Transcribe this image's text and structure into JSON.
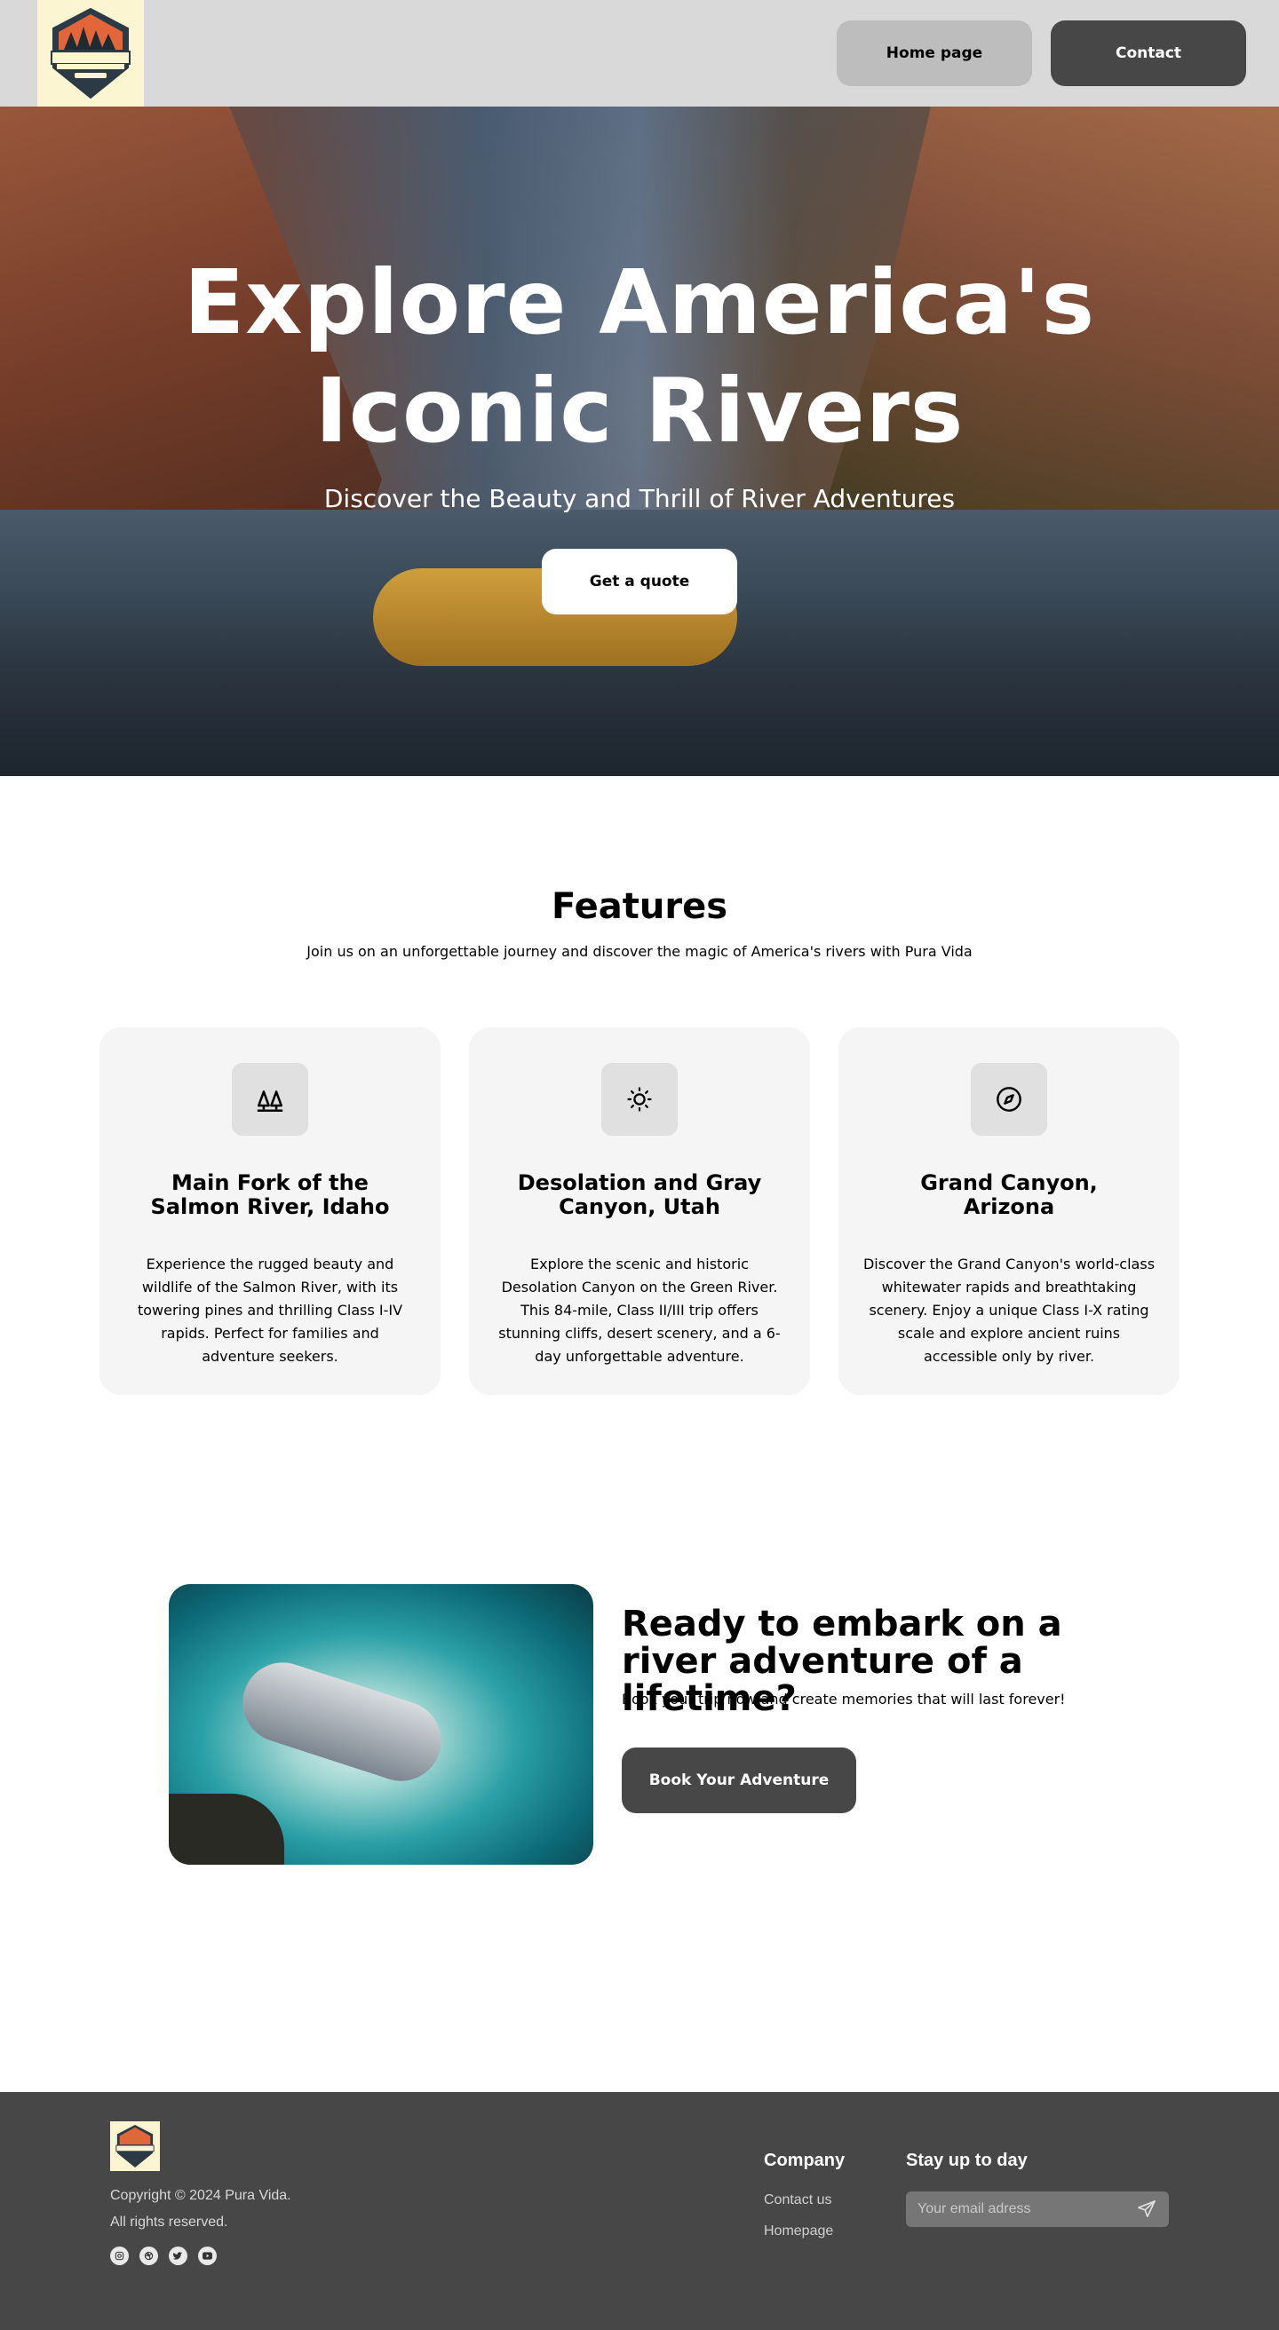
{
  "nav": {
    "logo_alt": "Pura Vida Outdoor Adventure",
    "home_label": "Home page",
    "contact_label": "Contact"
  },
  "hero": {
    "title_line1": "Explore America's",
    "title_line2": "Iconic Rivers",
    "subtitle": "Discover the Beauty and Thrill of River Adventures",
    "cta_label": "Get a quote"
  },
  "features": {
    "title": "Features",
    "lead": "Join us on an unforgettable journey and discover the magic of America's rivers with Pura Vida",
    "cards": [
      {
        "icon": "trees-icon",
        "title": "Main Fork of the Salmon River, Idaho",
        "text": "Experience the rugged beauty and wildlife of the Salmon River, with its towering pines and thrilling Class I-IV rapids. Perfect for families and adventure seekers."
      },
      {
        "icon": "sun-icon",
        "title": "Desolation and Gray Canyon, Utah",
        "text": "Explore the scenic and historic Desolation Canyon on the Green River. This 84-mile, Class II/III trip offers stunning cliffs, desert scenery, and a 6-day unforgettable adventure."
      },
      {
        "icon": "compass-icon",
        "title": "Grand Canyon, Arizona",
        "text": "Discover the Grand Canyon's world-class whitewater rapids and breathtaking scenery. Enjoy a unique Class I-X rating scale and explore ancient ruins accessible only by river."
      }
    ]
  },
  "cta": {
    "title": "Ready to embark on a river adventure of a lifetime?",
    "text": "Book your trip now and create memories that will last forever!",
    "button_label": "Book Your Adventure"
  },
  "footer": {
    "copyright_line1": "Copyright © 2024 Pura Vida.",
    "copyright_line2": "All rights reserved.",
    "socials": [
      "instagram-icon",
      "dribbble-icon",
      "twitter-icon",
      "youtube-icon"
    ],
    "company_heading": "Company",
    "company_links": [
      "Contact us",
      "Homepage"
    ],
    "newsletter_heading": "Stay up to day",
    "email_placeholder": "Your email adress"
  },
  "colors": {
    "nav_bg": "#d9d9d9",
    "dark_button": "#474747",
    "light_button": "#bdbdbd",
    "card_bg": "#f5f5f5",
    "footer_bg": "#474747",
    "logo_bg": "#fbf5d2"
  }
}
